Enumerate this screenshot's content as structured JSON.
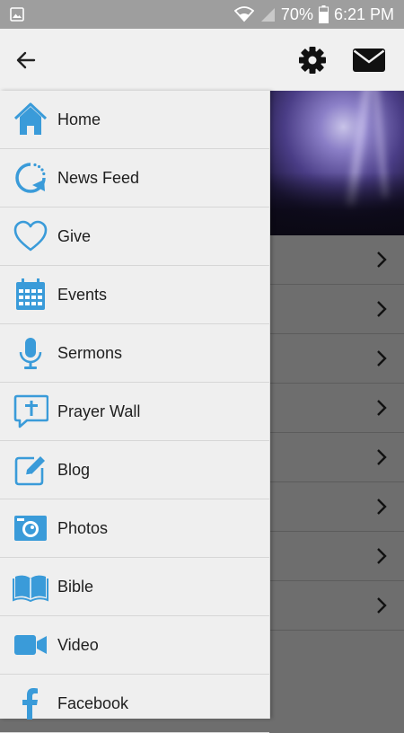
{
  "status_bar": {
    "battery": "70%",
    "time": "6:21 PM",
    "icons": [
      "gallery-icon",
      "wifi-icon",
      "signal-icon",
      "battery-icon"
    ]
  },
  "toolbar": {
    "icons": [
      "back-arrow-icon",
      "gear-icon",
      "mail-icon"
    ]
  },
  "colors": {
    "accent": "#3a9bd9",
    "drawer_bg": "#efefef",
    "status_bar": "#9e9e9e",
    "content_bg": "#6e6e6e"
  },
  "drawer": {
    "items": [
      {
        "label": "Home",
        "icon": "home-icon"
      },
      {
        "label": "News Feed",
        "icon": "refresh-icon"
      },
      {
        "label": "Give",
        "icon": "heart-icon"
      },
      {
        "label": "Events",
        "icon": "calendar-icon"
      },
      {
        "label": "Sermons",
        "icon": "microphone-icon"
      },
      {
        "label": "Prayer Wall",
        "icon": "cross-bubble-icon"
      },
      {
        "label": "Blog",
        "icon": "edit-icon"
      },
      {
        "label": "Photos",
        "icon": "camera-icon"
      },
      {
        "label": "Bible",
        "icon": "book-icon"
      },
      {
        "label": "Video",
        "icon": "video-camera-icon"
      },
      {
        "label": "Facebook",
        "icon": "facebook-icon"
      }
    ]
  }
}
